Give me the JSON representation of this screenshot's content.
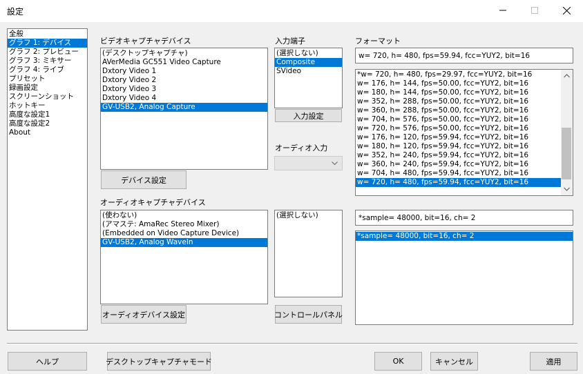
{
  "window": {
    "title": "設定"
  },
  "sidebar": {
    "items": [
      {
        "label": "全般",
        "selected": false
      },
      {
        "label": "グラフ 1: デバイス",
        "selected": true
      },
      {
        "label": "グラフ 2: プレビュー",
        "selected": false
      },
      {
        "label": "グラフ 3: ミキサー",
        "selected": false
      },
      {
        "label": "グラフ 4: ライブ",
        "selected": false
      },
      {
        "label": "プリセット",
        "selected": false
      },
      {
        "label": "録画設定",
        "selected": false
      },
      {
        "label": "スクリーンショット",
        "selected": false
      },
      {
        "label": "ホットキー",
        "selected": false
      },
      {
        "label": "高度な設定1",
        "selected": false
      },
      {
        "label": "高度な設定2",
        "selected": false
      },
      {
        "label": "About",
        "selected": false
      }
    ]
  },
  "video": {
    "label": "ビデオキャプチャデバイス",
    "devices": [
      {
        "label": "(デスクトップキャプチャ)",
        "selected": false
      },
      {
        "label": "AVerMedia GC551 Video Capture",
        "selected": false
      },
      {
        "label": "Dxtory Video 1",
        "selected": false
      },
      {
        "label": "Dxtory Video 2",
        "selected": false
      },
      {
        "label": "Dxtory Video 3",
        "selected": false
      },
      {
        "label": "Dxtory Video 4",
        "selected": false
      },
      {
        "label": "GV-USB2, Analog Capture",
        "selected": true
      }
    ],
    "settings_button": "デバイス設定"
  },
  "input_terminal": {
    "label": "入力端子",
    "items": [
      {
        "label": "(選択しない)",
        "selected": false
      },
      {
        "label": "Composite",
        "selected": true
      },
      {
        "label": "SVideo",
        "selected": false
      }
    ],
    "settings_button": "入力設定"
  },
  "audio_input": {
    "label": "オーディオ入力",
    "value": ""
  },
  "format": {
    "label": "フォーマット",
    "current": "w= 720, h= 480, fps=59.94,  fcc=YUY2, bit=16",
    "items": [
      {
        "label": "*w= 720, h= 480, fps=29.97,  fcc=YUY2, bit=16",
        "selected": false
      },
      {
        "label": "w= 176, h= 144, fps=50.00,  fcc=YUY2, bit=16",
        "selected": false
      },
      {
        "label": "w= 180, h= 144, fps=50.00,  fcc=YUY2, bit=16",
        "selected": false
      },
      {
        "label": "w= 352, h= 288, fps=50.00,  fcc=YUY2, bit=16",
        "selected": false
      },
      {
        "label": "w= 360, h= 288, fps=50.00,  fcc=YUY2, bit=16",
        "selected": false
      },
      {
        "label": "w= 704, h= 576, fps=50.00,  fcc=YUY2, bit=16",
        "selected": false
      },
      {
        "label": "w= 720, h= 576, fps=50.00,  fcc=YUY2, bit=16",
        "selected": false
      },
      {
        "label": "w= 176, h= 120, fps=59.94,  fcc=YUY2, bit=16",
        "selected": false
      },
      {
        "label": "w= 180, h= 120, fps=59.94,  fcc=YUY2, bit=16",
        "selected": false
      },
      {
        "label": "w= 352, h= 240, fps=59.94,  fcc=YUY2, bit=16",
        "selected": false
      },
      {
        "label": "w= 360, h= 240, fps=59.94,  fcc=YUY2, bit=16",
        "selected": false
      },
      {
        "label": "w= 704, h= 480, fps=59.94,  fcc=YUY2, bit=16",
        "selected": false
      },
      {
        "label": "w= 720, h= 480, fps=59.94,  fcc=YUY2, bit=16",
        "selected": true
      }
    ]
  },
  "audio": {
    "label": "オーディオキャプチャデバイス",
    "devices": [
      {
        "label": "(使わない)",
        "selected": false
      },
      {
        "label": "(アマステ: AmaRec Stereo Mixer)",
        "selected": false
      },
      {
        "label": "(Embedded on Video Capture Device)",
        "selected": false
      },
      {
        "label": "GV-USB2, Analog WaveIn",
        "selected": true
      }
    ],
    "settings_button": "オーディオデバイス設定",
    "input_items": [
      {
        "label": "(選択しない)",
        "selected": false
      }
    ],
    "control_panel_button": "コントロールパネル",
    "format_current": "*sample= 48000, bit=16, ch= 2",
    "format_items": [
      {
        "label": "*sample= 48000, bit=16, ch= 2",
        "selected": true
      }
    ]
  },
  "footer": {
    "help": "ヘルプ",
    "desktop_mode": "デスクトップキャプチャモード",
    "ok": "OK",
    "cancel": "キャンセル",
    "apply": "適用"
  },
  "colors": {
    "selection": "#0078d7",
    "background": "#f0f0f0"
  }
}
